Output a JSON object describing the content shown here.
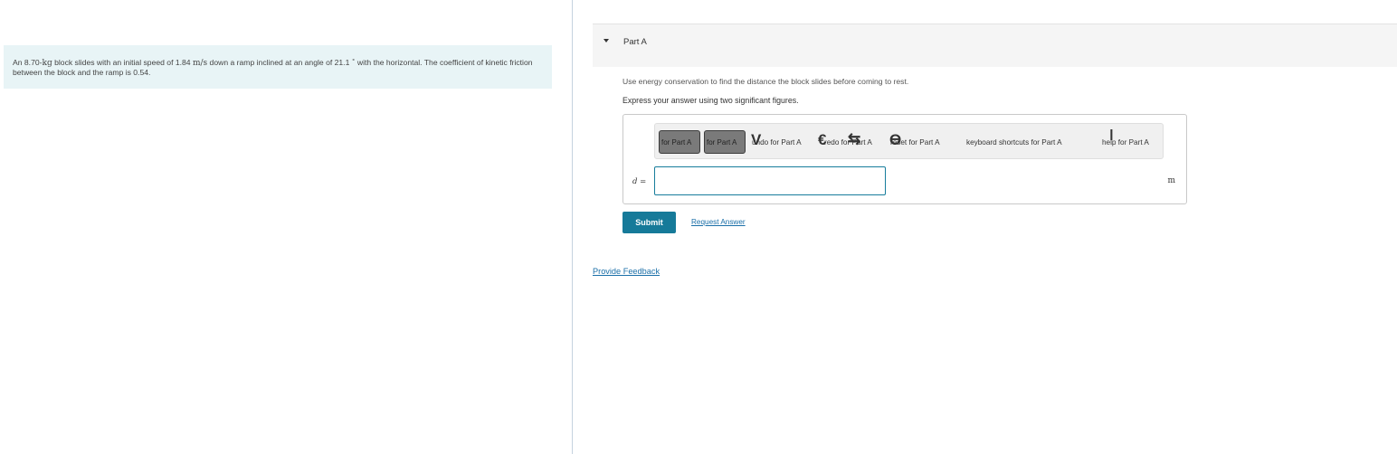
{
  "problem": {
    "text_1": "An 8.70-",
    "mass_unit": "kg",
    "text_2": " block slides with an initial speed of 1.84 ",
    "speed_unit": "m/s",
    "text_3": " down a ramp inclined at an angle of 21.1 ",
    "degree": "∘",
    "text_4": " with the horizontal. The coefficient of kinetic friction between the block and the ramp is 0.54."
  },
  "part": {
    "title": "Part A",
    "instruction": "Use energy conservation to find the distance the block slides before coming to rest.",
    "express": "Express your answer using two significant figures."
  },
  "toolbar": {
    "template_button_label": "for Part A",
    "symbols_button_label": "for Part A",
    "undo_label": "undo for Part A",
    "redo_label": "redo for Part A",
    "reset_label": "reset for Part A",
    "keyboard_label": "keyboard shortcuts for Part A",
    "help_label": "help for Part A",
    "glyph_1": "V",
    "glyph_2": "€",
    "glyph_3": "⇆",
    "glyph_4": "Ө",
    "glyph_5": "ǀ"
  },
  "answer": {
    "variable": "d =",
    "value": "",
    "unit": "m"
  },
  "actions": {
    "submit_label": "Submit",
    "request_answer_label": "Request Answer",
    "feedback_label": "Provide Feedback"
  }
}
